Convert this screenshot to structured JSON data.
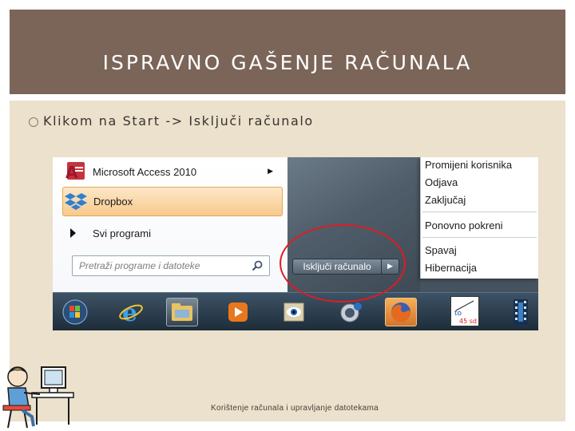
{
  "slide": {
    "title": "ISPRAVNO GAŠENJE RAČUNALA",
    "bullet": "Klikom na Start -> Isključi računalo",
    "footer": "Korištenje računala i upravljanje datotekama"
  },
  "start_menu": {
    "items": [
      {
        "label": "Microsoft Access 2010",
        "icon": "access-icon",
        "has_submenu": true
      },
      {
        "label": "Dropbox",
        "icon": "dropbox-icon",
        "highlighted": true
      },
      {
        "label": "Svi programi",
        "icon": "triangle-right-icon"
      }
    ],
    "search_placeholder": "Pretraži programe i datoteke",
    "shutdown_label": "Isključi računalo"
  },
  "shutdown_submenu": {
    "group1": [
      "Promijeni korisnika",
      "Odjava",
      "Zaključaj"
    ],
    "group2": [
      "Ponovno pokreni"
    ],
    "group3": [
      "Spavaj",
      "Hibernacija"
    ]
  },
  "taskbar": {
    "items": [
      "windows-start-orb-icon",
      "internet-explorer-icon",
      "file-explorer-icon",
      "media-player-icon",
      "photo-viewer-icon",
      "camera-icon",
      "firefox-icon",
      "notepad-icon",
      "film-strip-icon"
    ],
    "notepad_text": [
      "to",
      "45 sd"
    ]
  },
  "colors": {
    "title_bar": "#7a6558",
    "content_bg": "#ebe1cc",
    "highlight_ring": "#e01b24",
    "dropbox_highlight": "#f7c98b"
  }
}
